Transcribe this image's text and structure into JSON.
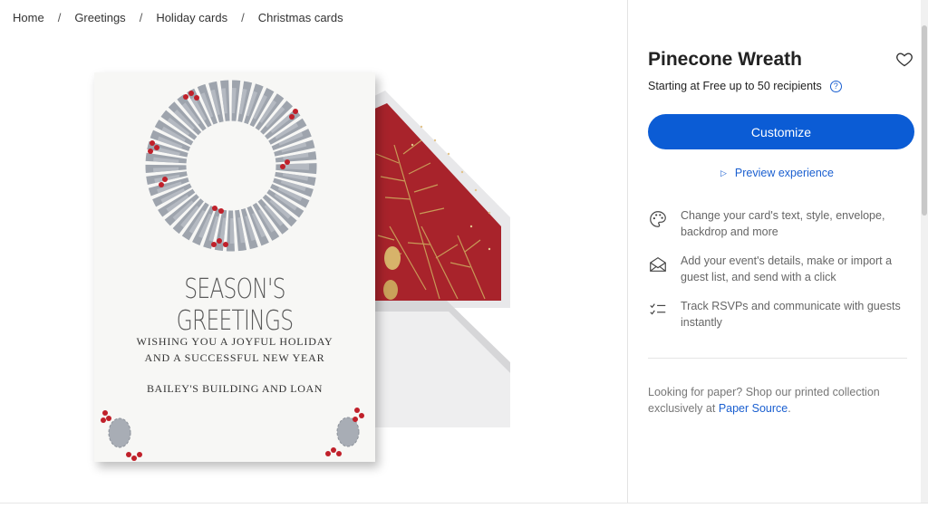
{
  "breadcrumb": [
    "Home",
    "Greetings",
    "Holiday cards",
    "Christmas cards"
  ],
  "card": {
    "headline": "SEASON'S GREETINGS",
    "line1": "WISHING YOU A JOYFUL HOLIDAY",
    "line2": "AND A SUCCESSFUL NEW YEAR",
    "signature": "BAILEY'S BUILDING AND LOAN"
  },
  "product": {
    "title": "Pinecone Wreath",
    "price_text": "Starting at Free up to 50 recipients",
    "help_icon": "?"
  },
  "actions": {
    "customize_label": "Customize",
    "preview_label": "Preview experience"
  },
  "features": [
    {
      "icon": "palette-icon",
      "text": "Change your card's text, style, envelope, backdrop and more"
    },
    {
      "icon": "envelope-icon",
      "text": "Add your event's details, make or import a guest list, and send with a click"
    },
    {
      "icon": "checklist-icon",
      "text": "Track RSVPs and communicate with guests instantly"
    }
  ],
  "paper": {
    "text": "Looking for paper? Shop our printed collection exclusively at ",
    "link": "Paper Source",
    "suffix": "."
  },
  "colors": {
    "primary": "#0b5cd5",
    "link": "#1a5fd0",
    "envelope_liner": "#a8232b",
    "wreath": "#9ea4ad",
    "berries": "#c0202a"
  }
}
